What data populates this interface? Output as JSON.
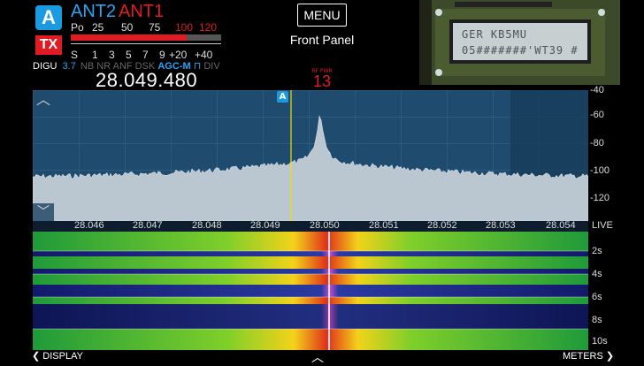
{
  "status": {
    "slice_letter": "A",
    "tx_label": "TX",
    "ant_rx": "ANT2",
    "ant_tx": "ANT1",
    "po_label": "Po",
    "po_ticks": [
      "25",
      "50",
      "75",
      "100",
      "120"
    ],
    "s_label": "S",
    "s_ticks": [
      "1",
      "3",
      "5",
      "7",
      "9",
      "+20",
      "+40"
    ],
    "mode": "DIGU",
    "bandwidth": "3.7",
    "filters": [
      "NB",
      "NR",
      "ANF",
      "DSK"
    ],
    "agc": "AGC-M",
    "div": "DIV",
    "frequency": "28.049.480",
    "power_level": 0.77,
    "colors": {
      "accent": "#1a9ae0",
      "tx": "#e01b24",
      "agc": "#2aa4f4"
    }
  },
  "menu": {
    "button_label": "MENU",
    "subtitle": "Front Panel",
    "rf_label": "RF PWR",
    "rf_value": "13"
  },
  "lcd": {
    "line1": "GER KB5MU",
    "line2": "05#######'WT39 #"
  },
  "panadapter": {
    "marker_letter": "A",
    "dbm_ticks": [
      "-40",
      "-60",
      "-80",
      "-100",
      "-120"
    ],
    "freq_ticks": [
      "28.046",
      "28.047",
      "28.048",
      "28.049",
      "28.050",
      "28.051",
      "28.052",
      "28.053",
      "28.054"
    ]
  },
  "waterfall": {
    "live_label": "LIVE",
    "time_ticks": [
      "2s",
      "4s",
      "6s",
      "8s",
      "10s"
    ]
  },
  "bottom": {
    "display_label": "DISPLAY",
    "meters_label": "METERS"
  }
}
